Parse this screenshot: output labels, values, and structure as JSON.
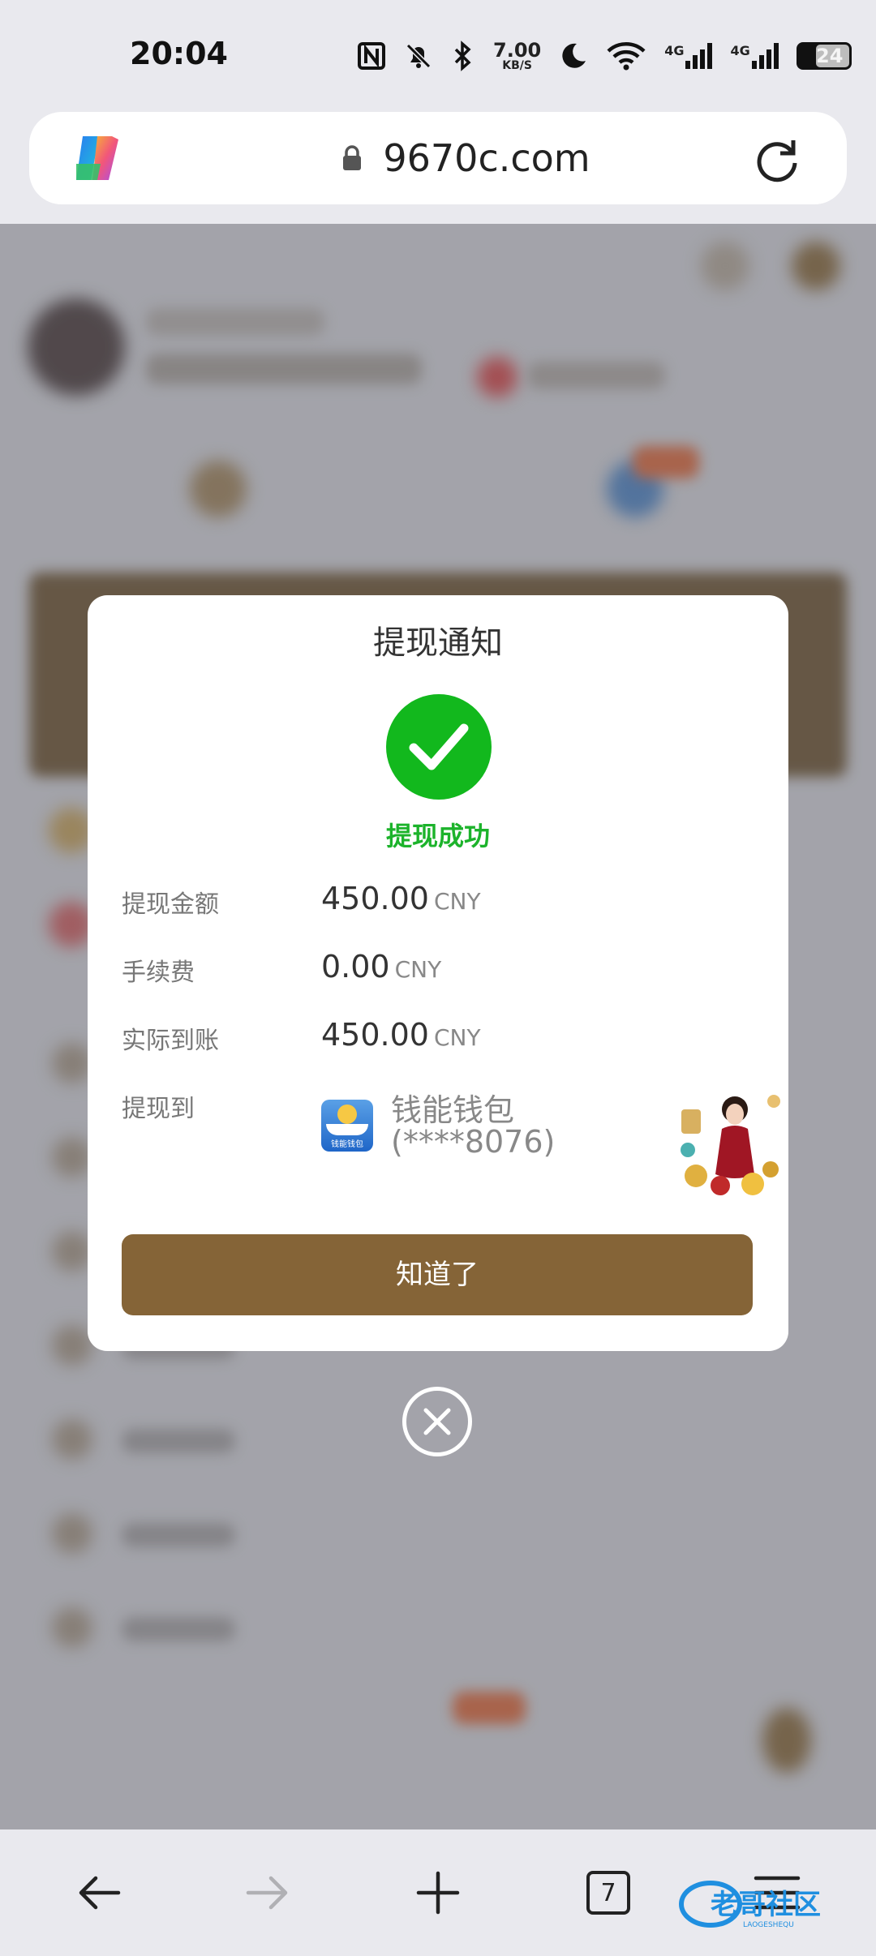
{
  "status_bar": {
    "time": "20:04",
    "speed_value": "7.00",
    "speed_unit": "KB/S",
    "network_1": "4G",
    "network_2": "4G",
    "battery": "24",
    "icons": [
      "nfc-icon",
      "mute-icon",
      "bluetooth-icon",
      "moon-icon",
      "wifi-icon",
      "signal-icon",
      "battery-icon"
    ]
  },
  "address_bar": {
    "url": "9670c.com",
    "icons": [
      "copilot-icon",
      "lock-icon",
      "reload-icon"
    ]
  },
  "dialog": {
    "title": "提现通知",
    "status": "提现成功",
    "rows": [
      {
        "label": "提现金额",
        "value": "450.00",
        "unit": "CNY"
      },
      {
        "label": "手续费",
        "value": "0.00",
        "unit": "CNY"
      },
      {
        "label": "实际到账",
        "value": "450.00",
        "unit": "CNY"
      }
    ],
    "destination": {
      "label": "提现到",
      "wallet_name": "钱能钱包",
      "account": "(****8076)",
      "wallet_icon_text": "钱能钱包"
    },
    "ok_button": "知道了"
  },
  "bottom_nav": {
    "tab_count": "7",
    "watermark": "老哥社区",
    "watermark_sub": "LAOGESHEQU"
  },
  "colors": {
    "accent": "#856437",
    "success": "#12b81d",
    "success_text": "#1cb32b"
  }
}
